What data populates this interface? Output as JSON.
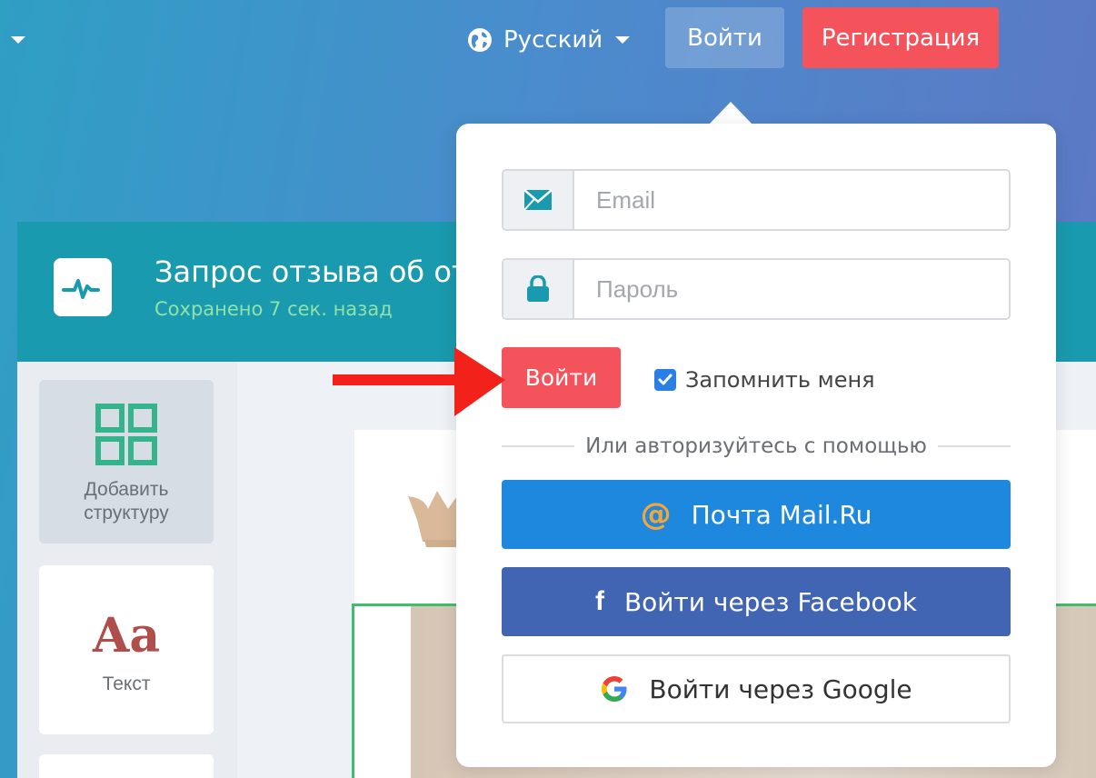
{
  "topbar": {
    "language": "Русский",
    "login_label": "Войти",
    "register_label": "Регистрация"
  },
  "app": {
    "title": "Запрос отзыва об от",
    "saved_status": "Сохранено 7 сек. назад",
    "sidebar": {
      "tiles": [
        {
          "label": "Добавить структуру",
          "icon": "grid-icon"
        },
        {
          "label": "Текст",
          "icon": "Aa"
        }
      ]
    }
  },
  "login": {
    "email_placeholder": "Email",
    "password_placeholder": "Пароль",
    "submit_label": "Войти",
    "remember_label": "Запомнить меня",
    "remember_checked": true,
    "divider_text": "Или авторизуйтесь с помощью",
    "social": {
      "mailru": "Почта Mail.Ru",
      "facebook": "Войти через Facebook",
      "google": "Войти через Google"
    }
  },
  "colors": {
    "accent_red": "#f4535c",
    "teal": "#1a9aae",
    "mailru_blue": "#1e88df",
    "facebook_blue": "#4265b3",
    "checkbox_blue": "#2a7fe4"
  }
}
